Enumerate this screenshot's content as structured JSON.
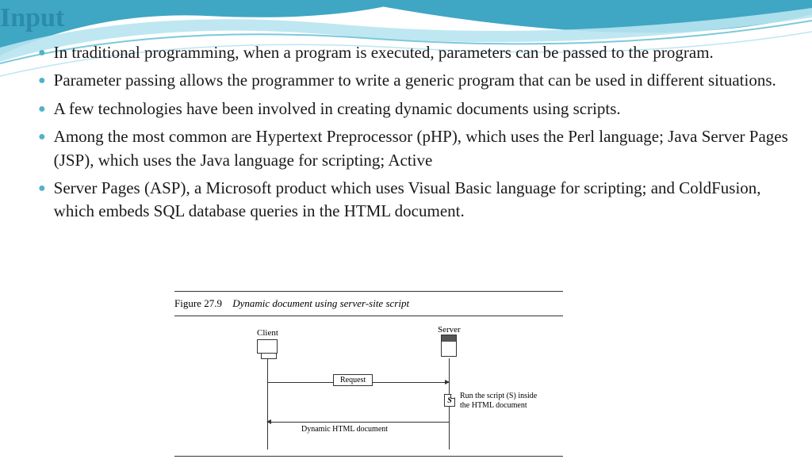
{
  "title": "Input",
  "bullets": [
    "In traditional programming, when a program is executed, parameters can be passed to the program.",
    "Parameter passing allows the programmer to write a generic program that can be used in different situations.",
    "A few technologies have been involved in creating dynamic documents using scripts.",
    "Among the most common are Hypertext Preprocessor (pHP), which uses the Perl language; Java Server Pages (JSP), which uses the Java language for scripting; Active",
    "Server Pages (ASP), a Microsoft product which uses Visual Basic language for scripting; and ColdFusion, which embeds SQL database queries in the HTML document."
  ],
  "figure": {
    "number": "Figure 27.9",
    "caption": "Dynamic document using server-site script",
    "client_label": "Client",
    "server_label": "Server",
    "request_label": "Request",
    "script_marker": "S",
    "script_note": "Run the script (S) inside the HTML document",
    "response_label": "Dynamic HTML document"
  }
}
